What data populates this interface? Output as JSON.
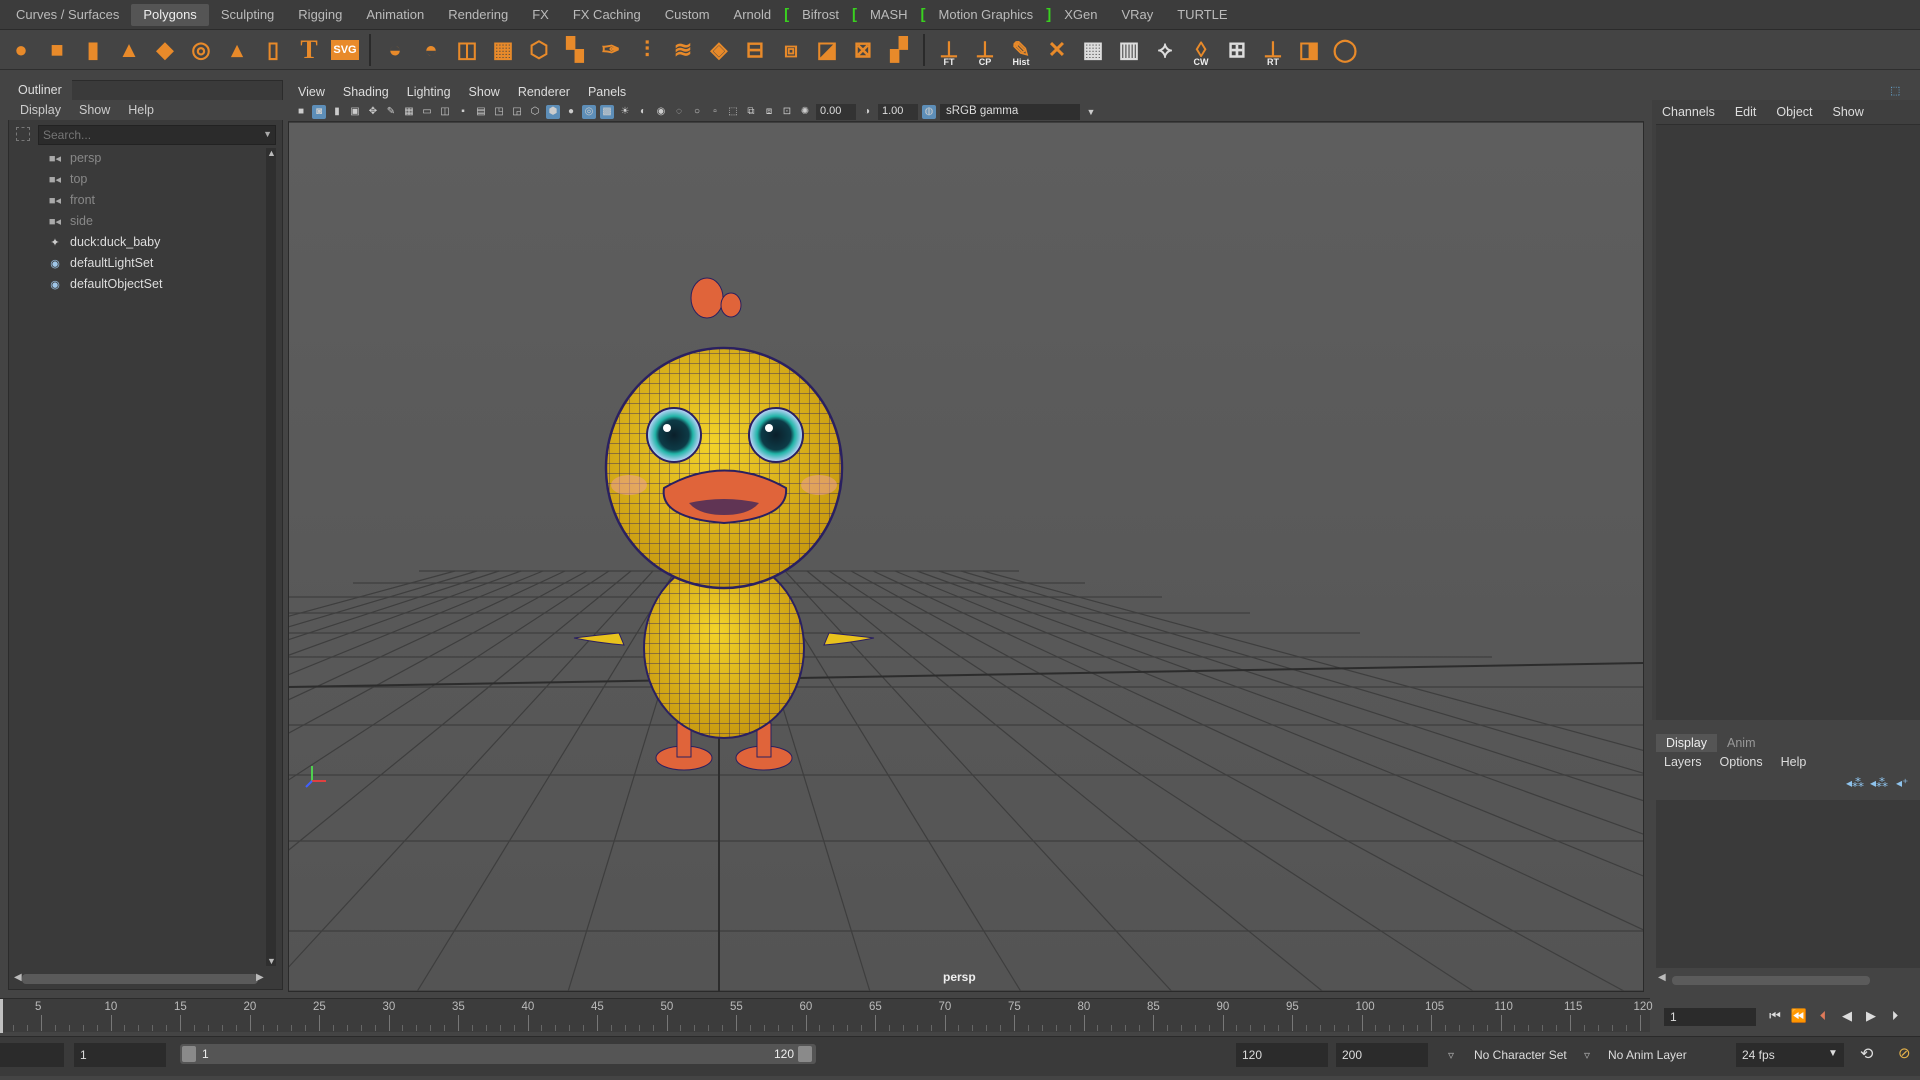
{
  "shelf": {
    "tabs": [
      "Curves / Surfaces",
      "Polygons",
      "Sculpting",
      "Rigging",
      "Animation",
      "Rendering",
      "FX",
      "FX Caching",
      "Custom",
      "Arnold",
      "Bifrost",
      "MASH",
      "Motion Graphics",
      "XGen",
      "VRay",
      "TURTLE"
    ],
    "active_tab": "Polygons",
    "icon_labels": {
      "ft": "FT",
      "cp": "CP",
      "hist": "Hist",
      "cw": "CW",
      "rt": "RT",
      "svg": "SVG",
      "t": "T"
    }
  },
  "outliner": {
    "title": "Outliner",
    "menu": [
      "Display",
      "Show",
      "Help"
    ],
    "search_placeholder": "Search...",
    "items": [
      {
        "label": "persp",
        "icon": "camera-icon",
        "dim": true
      },
      {
        "label": "top",
        "icon": "camera-icon",
        "dim": true
      },
      {
        "label": "front",
        "icon": "camera-icon",
        "dim": true
      },
      {
        "label": "side",
        "icon": "camera-icon",
        "dim": true
      },
      {
        "label": "duck:duck_baby",
        "icon": "group-icon",
        "dim": false
      },
      {
        "label": "defaultLightSet",
        "icon": "set-icon",
        "dim": false
      },
      {
        "label": "defaultObjectSet",
        "icon": "set-icon",
        "dim": false
      }
    ]
  },
  "viewport": {
    "menu": [
      "View",
      "Shading",
      "Lighting",
      "Show",
      "Renderer",
      "Panels"
    ],
    "exposure": "0.00",
    "gamma_value": "1.00",
    "color_space": "sRGB gamma",
    "camera_label": "persp",
    "colors": {
      "duck_body": "#e8c21d",
      "wire": "#2a2060",
      "beak": "#e0643a",
      "eye": "#1fa8a0"
    }
  },
  "channels": {
    "menu": [
      "Channels",
      "Edit",
      "Object",
      "Show"
    ]
  },
  "layers": {
    "tabs": [
      "Display",
      "Anim"
    ],
    "active_tab": "Display",
    "menu": [
      "Layers",
      "Options",
      "Help"
    ]
  },
  "timeline": {
    "ticks": [
      5,
      10,
      15,
      20,
      25,
      30,
      35,
      40,
      45,
      50,
      55,
      60,
      65,
      70,
      75,
      80,
      85,
      90,
      95,
      100,
      105,
      110,
      115,
      120
    ],
    "current_frame": "1"
  },
  "range": {
    "start": "1",
    "inner_start": "1",
    "inner_end": "120",
    "end": "120",
    "anim_end": "200",
    "character_set": "No Character Set",
    "anim_layer": "No Anim Layer",
    "fps": "24 fps"
  }
}
